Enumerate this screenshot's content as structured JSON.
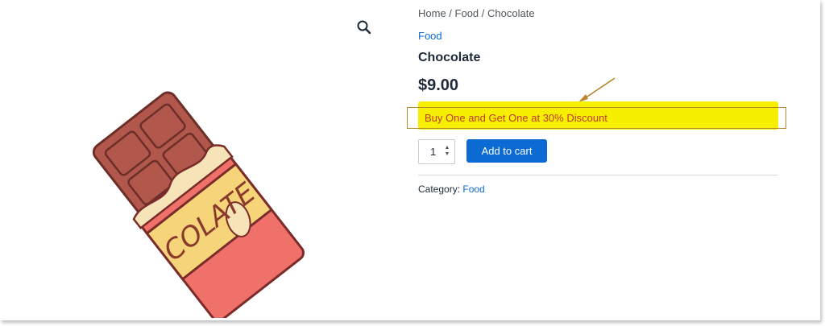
{
  "breadcrumb": {
    "home": "Home",
    "sep": " / ",
    "category": "Food",
    "current": "Chocolate"
  },
  "product": {
    "category_link": "Food",
    "title": "Chocolate",
    "price": "$9.00",
    "promo": "Buy One and Get One at 30% Discount",
    "quantity": "1",
    "add_to_cart": "Add to cart",
    "meta_label": "Category:",
    "meta_value": "Food"
  },
  "image": {
    "wrapper_text": "COLATE"
  },
  "icons": {
    "zoom": "search-icon",
    "annotation": "arrow-icon"
  },
  "colors": {
    "accent": "#0b6ad3",
    "highlight": "#f7ef00",
    "promo_text": "#c0392b",
    "annotation": "#b8862b"
  }
}
